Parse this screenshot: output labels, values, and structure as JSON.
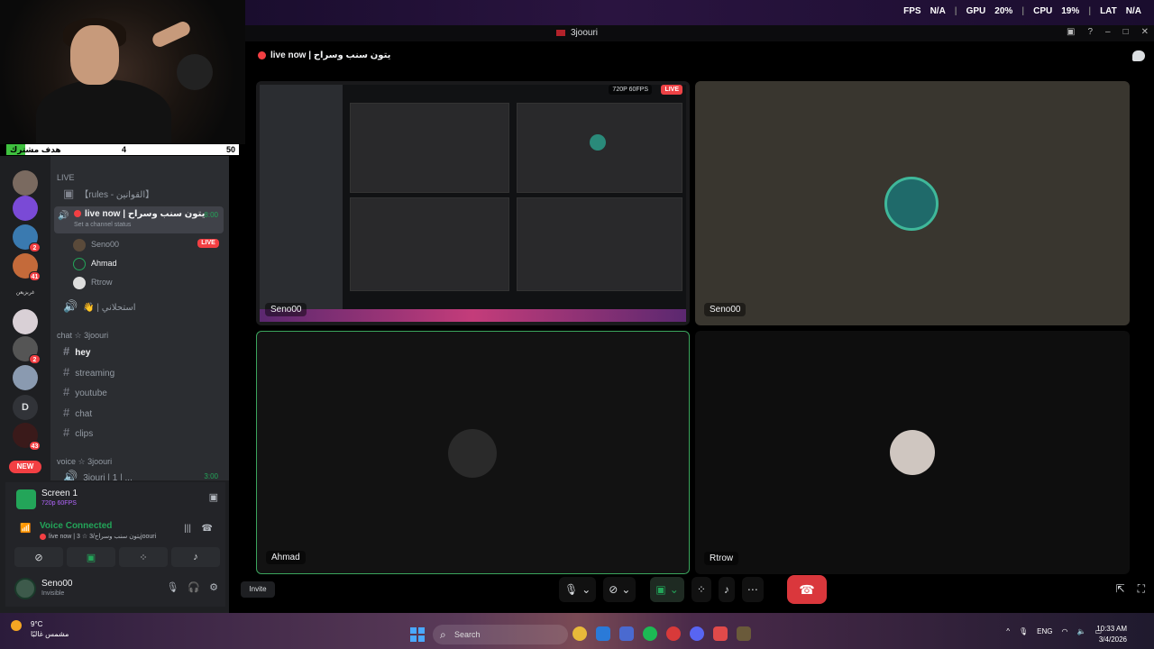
{
  "perf": {
    "fps_label": "FPS",
    "fps": "N/A",
    "gpu_label": "GPU",
    "gpu": "20%",
    "cpu_label": "CPU",
    "cpu": "19%",
    "lat_label": "LAT",
    "lat": "N/A"
  },
  "window": {
    "title": "3joouri"
  },
  "goal": {
    "label": "هدف مشترك",
    "current": "4",
    "target": "50",
    "progress": 0.08
  },
  "servers": [
    {
      "badge": ""
    },
    {
      "badge": ""
    },
    {
      "badge": "2"
    },
    {
      "badge": "41"
    },
    {
      "text": "غربزيعن"
    },
    {
      "badge": ""
    },
    {
      "badge": "2"
    },
    {
      "badge": ""
    },
    {
      "initial": "D"
    },
    {
      "badge": "43"
    }
  ],
  "new_badge": "NEW",
  "channels": {
    "cat_live": "LIVE",
    "rules": "【rules - القوانين】",
    "voice_active": {
      "name": "live now | يتون سنب وسراح",
      "timer": "8:00",
      "status": "Set a channel status"
    },
    "members": [
      {
        "name": "Seno00",
        "live": "LIVE"
      },
      {
        "name": "Ahmad"
      },
      {
        "name": "Rtrow"
      }
    ],
    "voice2": "👋 | استحلاني",
    "cat_chat": "chat ☆ 3joouri",
    "text": [
      "hey",
      "streaming",
      "youtube",
      "chat",
      "clips"
    ],
    "cat_voice": "voice ☆ 3joouri",
    "voice3": "3jouri | 1 | ...",
    "voice3_timer": "3:00"
  },
  "panel": {
    "screen_title": "Screen 1",
    "screen_sub": "720p 60FPS",
    "voice_connected": "Voice Connected",
    "voice_channel": "live now | 3 ☆ يتون سنب وسراح/3joouri",
    "user_name": "Seno00",
    "user_status": "Invisible"
  },
  "main": {
    "channel_header": "live now | يتون سنب وسراح",
    "stream_quality": "720P 60FPS",
    "stream_live": "LIVE",
    "tiles": [
      "Seno00",
      "Seno00",
      "Ahmad",
      "Rtrow"
    ]
  },
  "controls": {
    "invite": "Invite"
  },
  "taskbar": {
    "temp": "9°C",
    "condition": "مشمس غالبًا",
    "search": "Search",
    "lang": "ENG",
    "time": "10:33 AM",
    "date": "3/4/2026"
  }
}
